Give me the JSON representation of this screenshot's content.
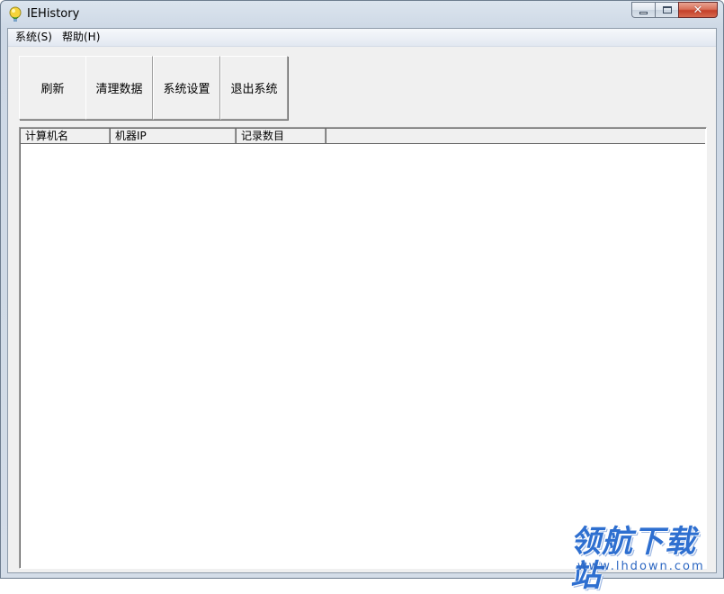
{
  "window": {
    "title": "IEHistory",
    "icon": "lightbulb-icon"
  },
  "caption_buttons": {
    "minimize_icon": "minimize-icon",
    "maximize_icon": "maximize-icon",
    "close_icon": "close-icon",
    "close_glyph": "✕"
  },
  "menubar": {
    "items": [
      {
        "label": "系统(S)"
      },
      {
        "label": "帮助(H)"
      }
    ]
  },
  "toolbar": {
    "buttons": [
      {
        "label": "刷新"
      },
      {
        "label": "清理数据"
      },
      {
        "label": "系统设置"
      },
      {
        "label": "退出系统"
      }
    ]
  },
  "listview": {
    "columns": [
      {
        "label": "计算机名"
      },
      {
        "label": "机器IP"
      },
      {
        "label": "记录数目"
      }
    ],
    "rows": []
  },
  "watermark": {
    "text": "领航下载站",
    "url": "www.lhdown.com"
  },
  "colors": {
    "frame": "#d4dde8",
    "close_button": "#c4402a",
    "watermark": "#2e6fd0"
  }
}
